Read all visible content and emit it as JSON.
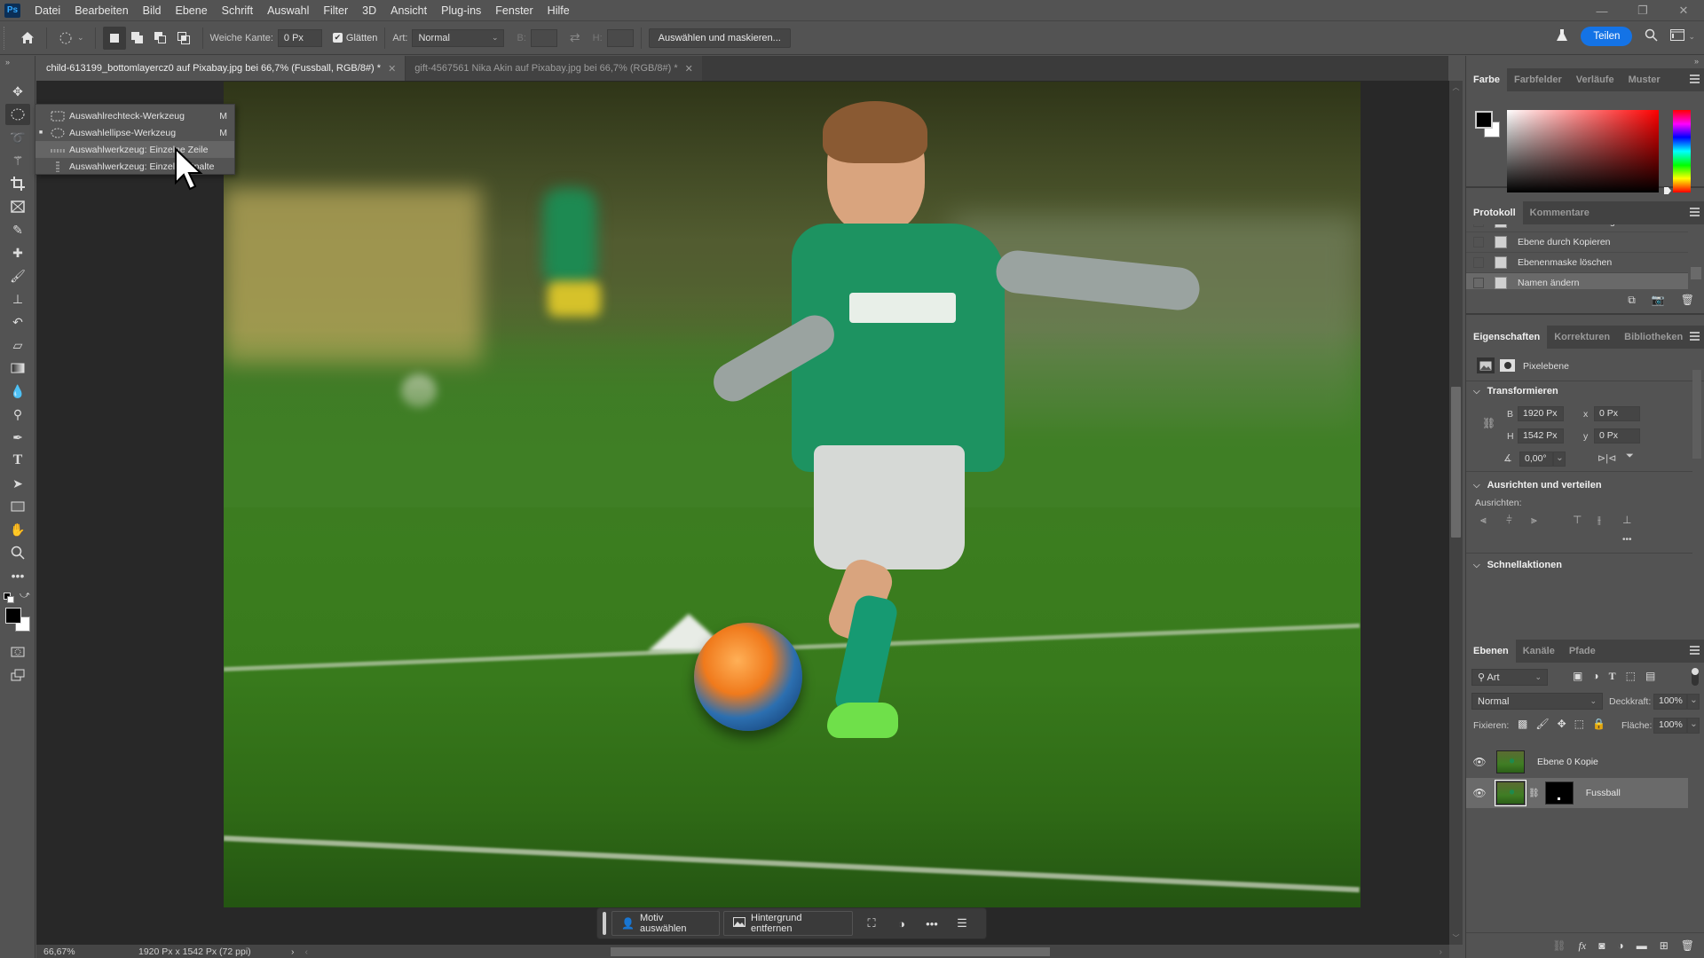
{
  "app": {
    "logo": "Ps",
    "menu": [
      "Datei",
      "Bearbeiten",
      "Bild",
      "Ebene",
      "Schrift",
      "Auswahl",
      "Filter",
      "3D",
      "Ansicht",
      "Plug-ins",
      "Fenster",
      "Hilfe"
    ],
    "window_controls": {
      "minimize": "—",
      "restore": "❐",
      "close": "✕"
    }
  },
  "options_bar": {
    "feather_label": "Weiche Kante:",
    "feather_value": "0 Px",
    "antialias_label": "Glätten",
    "antialias_checked": true,
    "style_label": "Art:",
    "style_value": "Normal",
    "width_label": "B:",
    "height_label": "H:",
    "select_mask_button": "Auswählen und maskieren...",
    "share_button": "Teilen"
  },
  "tabs": [
    {
      "label": "child-613199_bottomlayercz0 auf Pixabay.jpg bei 66,7% (Fussball, RGB/8#) *",
      "active": true
    },
    {
      "label": "gift-4567561 Nika Akin auf Pixabay.jpg bei 66,7% (RGB/8#) *",
      "active": false
    }
  ],
  "tool_flyout": {
    "items": [
      {
        "label": "Auswahlrechteck-Werkzeug",
        "shortcut": "M",
        "selected": false,
        "hover": false
      },
      {
        "label": "Auswahlellipse-Werkzeug",
        "shortcut": "M",
        "selected": true,
        "hover": false
      },
      {
        "label": "Auswahlwerkzeug: Einzelne Zeile",
        "shortcut": "",
        "selected": false,
        "hover": true
      },
      {
        "label": "Auswahlwerkzeug: Einzelne Spalte",
        "shortcut": "",
        "selected": false,
        "hover": false
      }
    ]
  },
  "status_bar": {
    "zoom": "66,67%",
    "doc_info": "1920 Px x 1542 Px (72 ppi)"
  },
  "task_bar": {
    "select_subject": "Motiv auswählen",
    "remove_background": "Hintergrund entfernen"
  },
  "color_panel": {
    "tabs": [
      "Farbe",
      "Farbfelder",
      "Verläufe",
      "Muster"
    ],
    "foreground": "#000000",
    "background": "#ffffff",
    "hue": "#ff0000"
  },
  "history_panel": {
    "tabs": [
      "Protokoll",
      "Kommentare"
    ],
    "items": [
      {
        "label": "Ebenenmaske hinzufügen",
        "active": false
      },
      {
        "label": "Ebene durch Kopieren",
        "active": false
      },
      {
        "label": "Ebenenmaske löschen",
        "active": false
      },
      {
        "label": "Namen ändern",
        "active": true
      }
    ]
  },
  "properties_panel": {
    "tabs": [
      "Eigenschaften",
      "Korrekturen",
      "Bibliotheken"
    ],
    "layer_type": "Pixelebene",
    "transform_title": "Transformieren",
    "width_label": "B",
    "width": "1920 Px",
    "height_label": "H",
    "height": "1542 Px",
    "x_label": "x",
    "x": "0 Px",
    "y_label": "y",
    "y": "0 Px",
    "angle": "0,00°",
    "align_title": "Ausrichten und verteilen",
    "align_label": "Ausrichten:",
    "quick_actions_title": "Schnellaktionen"
  },
  "layers_panel": {
    "tabs": [
      "Ebenen",
      "Kanäle",
      "Pfade"
    ],
    "filter_value": "Art",
    "blend_mode": "Normal",
    "opacity_label": "Deckkraft:",
    "opacity": "100%",
    "lock_label": "Fixieren:",
    "fill_label": "Fläche:",
    "fill": "100%",
    "layers": [
      {
        "name": "Ebene 0 Kopie",
        "visible": true,
        "active": false,
        "has_mask": false
      },
      {
        "name": "Fussball",
        "visible": true,
        "active": true,
        "has_mask": true
      }
    ]
  },
  "colors": {
    "accent": "#1473e6",
    "panel_bg": "#535353",
    "canvas_bg": "#282828"
  }
}
